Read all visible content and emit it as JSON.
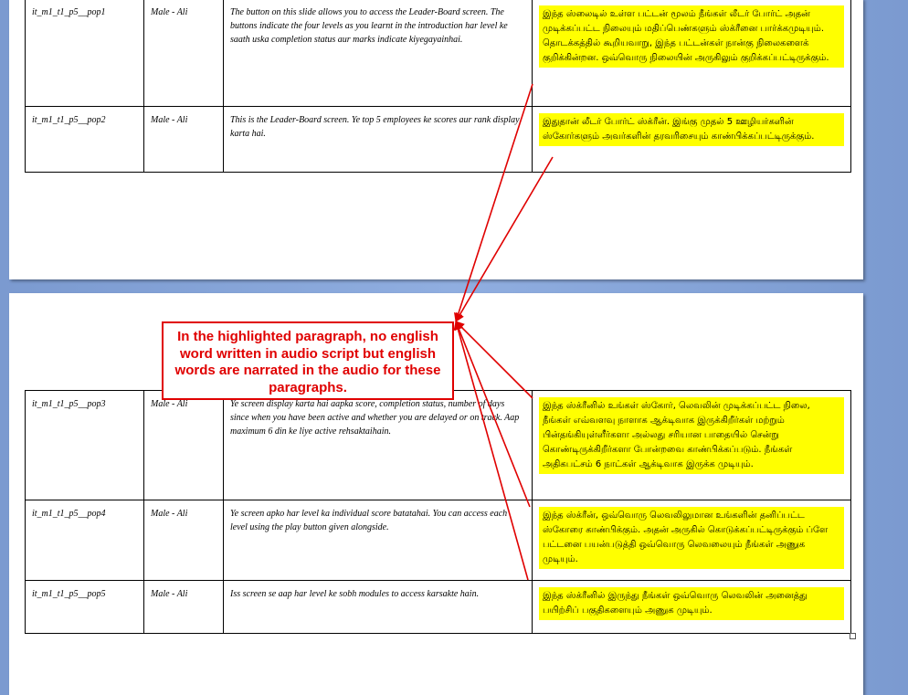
{
  "rows_page1": [
    {
      "id": "it_m1_t1_p5__pop1",
      "speaker": "Male - Ali",
      "english": "The button on this slide allows you to access the Leader-Board screen. The buttons indicate the four levels as you learnt in the introduction har level ke saath uska completion status aur marks indicate kiyegayainhai.",
      "tamil": "இந்த ஸ்லைடில் உள்ள பட்டன் மூலம் நீங்கள் லீடர் போர்ட் அதன் முடிக்கப்பட்ட நிலையும் மதிப்பெண்களும் ஸ்க்ரீனை பார்க்கமுடியும். தொடக்கத்தில் கூறியவாறு, இந்த பட்டன்கள் நான்கு நிலைகளைக் குறிக்கின்றன. ஒவ்வொரு நிலையின் அருகிலும் குறிக்கப்பட்டிருக்கும்."
    },
    {
      "id": "it_m1_t1_p5__pop2",
      "speaker": "Male - Ali",
      "english": "This is the Leader-Board screen.  Ye top 5 employees ke scores aur rank display karta hai.",
      "tamil": "இதுதான் லீடர் போர்ட் ஸ்க்ரீன். இங்கு முதல் 5 ஊழியர்களின் ஸ்கோர்களும் அவர்களின் தரவரிசையும் காண்பிக்கப்பட்டிருக்கும்."
    }
  ],
  "rows_page2": [
    {
      "id": "it_m1_t1_p5__pop3",
      "speaker": "Male - Ali",
      "english": "Ye screen display karta hai aapka score, completion status, number of days since when you have been active and whether you are delayed or on track. Aap maximum 6 din ke liye active rehsaktaihain.",
      "tamil": "இந்த ஸ்க்ரீனில் உங்கள் ஸ்கோர், லெவலின் முடிக்கப்பட்ட நிலை, நீங்கள் எவ்வளவு நாளாக ஆக்டிவாக இருக்கிறீர்கள் மற்றும் பின்தங்கியுள்ளீர்களா அல்லது சரியான பாதையில் சென்று கொண்டிருக்கிறீர்களா போன்றவை காண்பிக்கப்படும். நீங்கள் அதிகபட்சம் 6 நாட்கள் ஆக்டிவாக இருக்க முடியும்."
    },
    {
      "id": "it_m1_t1_p5__pop4",
      "speaker": "Male - Ali",
      "english": "Ye screen apko har level ka individual score batatahai. You can access each level using the play button given alongside.",
      "tamil": "இந்த ஸ்க்ரீன், ஒவ்வொரு லெவலிலுமான உங்களின் தனிப்பட்ட ஸ்கோரை காண்பிக்கும். அதன் அருகில் கொடுக்கப்பட்டிருக்கும் ப்ளே பட்டனை பயன்படுத்தி ஒவ்வொரு லெவலையும் நீங்கள் அணுக முடியும்."
    },
    {
      "id": "it_m1_t1_p5__pop5",
      "speaker": "Male - Ali",
      "english": "Iss screen se aap har level ke sobh modules to access karsakte hain.",
      "tamil": "இந்த ஸ்க்ரீனில் இருந்து நீங்கள் ஒவ்வொரு லெவலின் அனைத்து பயிற்சிப் பகுதிகளையும் அணுக முடியும்."
    }
  ],
  "callout": {
    "text": "In the highlighted paragraph, no english word written in audio script but english words are narrated in the audio for these paragraphs."
  },
  "colors": {
    "highlight": "#ffff00",
    "annotation": "#e00000",
    "workspace": "#7b9ad0"
  }
}
